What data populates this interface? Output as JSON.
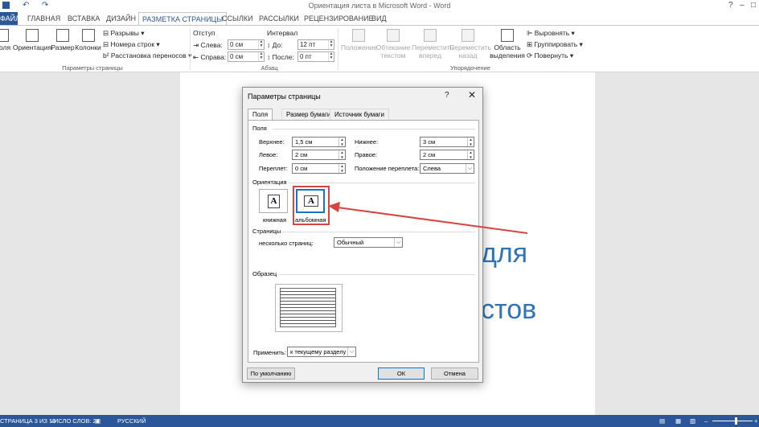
{
  "window": {
    "title": "Ориентация листа в Microsoft Word - Word",
    "controls": {
      "help": "?",
      "minimize": "–",
      "maximize": "□",
      "close": "✕"
    }
  },
  "quick_access": {
    "undo_icon": "↶",
    "redo_icon": "↷"
  },
  "tabs": {
    "file": "ФАЙЛ",
    "home": "ГЛАВНАЯ",
    "insert": "ВСТАВКА",
    "design": "ДИЗАЙН",
    "layout": "РАЗМЕТКА СТРАНИЦЫ",
    "references": "ССЫЛКИ",
    "mailings": "РАССЫЛКИ",
    "review": "РЕЦЕНЗИРОВАНИЕ",
    "view": "ВИД"
  },
  "ribbon": {
    "margins": "Поля",
    "orientation": "Ориентация",
    "size": "Размер",
    "columns": "Колонки",
    "breaks": "Разрывы",
    "line_numbers": "Номера строк",
    "hyphenation": "Расстановка переносов",
    "group_page_setup": "Параметры страницы",
    "indent_header": "Отступ",
    "spacing_header": "Интервал",
    "left_label": "Слева:",
    "right_label": "Справа:",
    "before_label": "До:",
    "after_label": "После:",
    "left_value": "0 см",
    "right_value": "0 см",
    "before_value": "12 пт",
    "after_value": "0 пт",
    "group_paragraph": "Абзац",
    "position": "Положение",
    "wrap_text": "Обтекание текстом",
    "bring_forward": "Переместить вперед",
    "send_backward": "Переместить назад",
    "selection_pane": "Область выделения",
    "align": "Выровнять",
    "group": "Группировать",
    "rotate": "Повернуть",
    "group_arrange": "Упорядочение"
  },
  "document": {
    "fragment_1": "для",
    "fragment_2": "стов"
  },
  "status_bar": {
    "page": "СТРАНИЦА 3 ИЗ 10",
    "words": "ЧИСЛО СЛОВ: 27",
    "language": "РУССКИЙ"
  },
  "dialog": {
    "title": "Параметры страницы",
    "help": "?",
    "close": "✕",
    "tabs": [
      "Поля",
      "Размер бумаги",
      "Источник бумаги"
    ],
    "margins_section": "Поля",
    "top_label": "Верхнее:",
    "top_value": "1,5 см",
    "bottom_label": "Нижнее:",
    "bottom_value": "3 см",
    "left_label": "Левое:",
    "left_value": "2 см",
    "right_label": "Правое:",
    "right_value": "2 см",
    "gutter_label": "Переплет:",
    "gutter_value": "0 см",
    "gutter_pos_label": "Положение переплета:",
    "gutter_pos_value": "Слева",
    "orientation_section": "Ориентация",
    "portrait_label": "книжная",
    "landscape_label": "альбомная",
    "pages_section": "Страницы",
    "multiple_pages_label": "несколько страниц:",
    "multiple_pages_value": "Обычный",
    "preview_section": "Образец",
    "apply_label": "Применить:",
    "apply_value": "к текущему разделу",
    "default_button": "По умолчанию",
    "ok_button": "ОК",
    "cancel_button": "Отмена"
  },
  "colors": {
    "accent": "#2b579a",
    "annotation": "#d64541",
    "heading_text": "#2e74b5"
  }
}
